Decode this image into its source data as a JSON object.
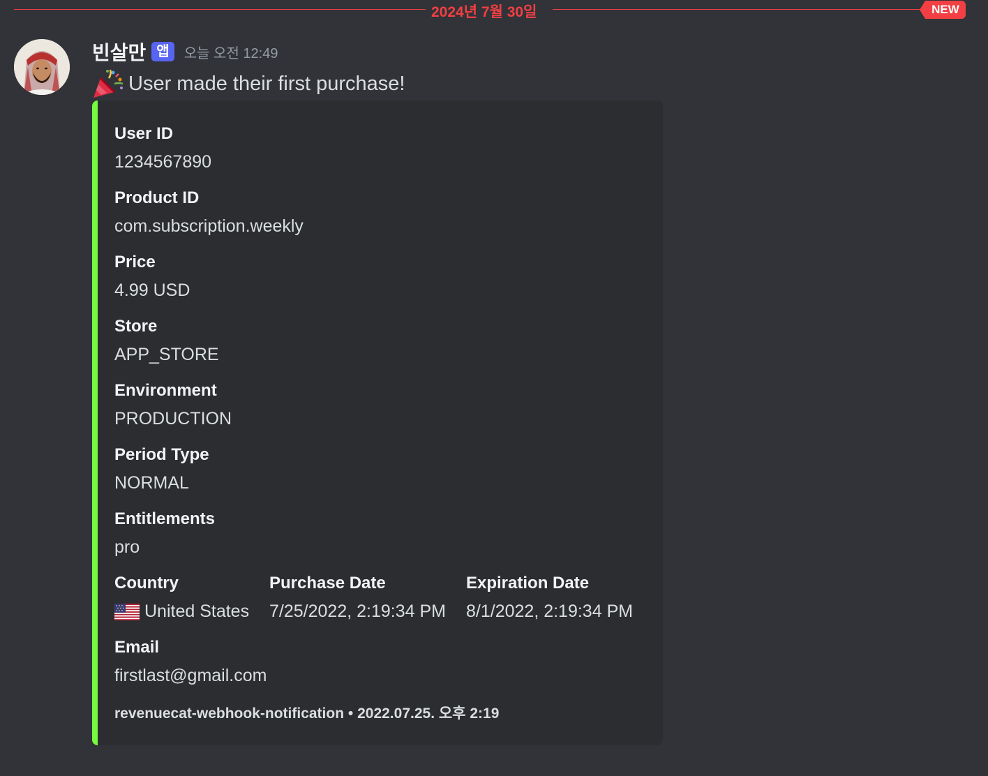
{
  "divider": {
    "date": "2024년 7월 30일",
    "new_label": "NEW"
  },
  "message": {
    "author": "빈살만",
    "app_tag": "앱",
    "timestamp": "오늘 오전 12:49",
    "text": "User made their first purchase!",
    "emoji": "party-popper-icon"
  },
  "embed": {
    "accent_color": "#77fa40",
    "fields": {
      "user_id": {
        "name": "User ID",
        "value": "1234567890"
      },
      "product_id": {
        "name": "Product ID",
        "value": "com.subscription.weekly"
      },
      "price": {
        "name": "Price",
        "value": "4.99 USD"
      },
      "store": {
        "name": "Store",
        "value": "APP_STORE"
      },
      "environment": {
        "name": "Environment",
        "value": "PRODUCTION"
      },
      "period_type": {
        "name": "Period Type",
        "value": "NORMAL"
      },
      "entitlements": {
        "name": "Entitlements",
        "value": "pro"
      },
      "country": {
        "name": "Country",
        "value": "United States",
        "flag": "us-flag-icon"
      },
      "purchase_date": {
        "name": "Purchase Date",
        "value": "7/25/2022, 2:19:34 PM"
      },
      "expiration_date": {
        "name": "Expiration Date",
        "value": "8/1/2022, 2:19:34 PM"
      },
      "email": {
        "name": "Email",
        "value": "firstlast@gmail.com"
      }
    },
    "footer": {
      "text": "revenuecat-webhook-notification",
      "separator": "•",
      "timestamp": "2022.07.25. 오후 2:19"
    }
  },
  "colors": {
    "background": "#313338",
    "embed_background": "#2b2d31",
    "new_marker": "#f23f43",
    "app_tag": "#5865f2"
  }
}
